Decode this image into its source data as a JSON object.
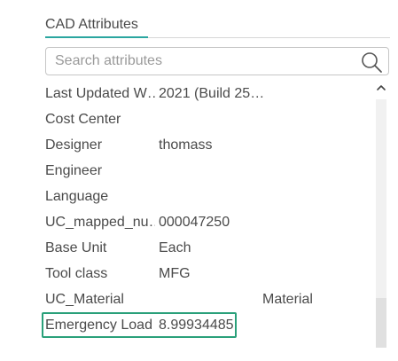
{
  "panel": {
    "tab_label": "CAD Attributes",
    "accent_color": "#2aa6a0",
    "highlight_color": "#2aa07a"
  },
  "search": {
    "placeholder": "Search attributes",
    "value": "",
    "icon": "search-icon"
  },
  "attributes": [
    {
      "key": "Last Updated W…",
      "value": "2021 (Build 25…"
    },
    {
      "key": "Cost Center",
      "value": ""
    },
    {
      "key": "Designer",
      "value": "thomass"
    },
    {
      "key": "Engineer",
      "value": ""
    },
    {
      "key": "Language",
      "value": ""
    },
    {
      "key": "UC_mapped_nu…",
      "value": "000047250"
    },
    {
      "key": "Base Unit",
      "value": "Each"
    },
    {
      "key": "Tool class",
      "value": "MFG"
    },
    {
      "key": "UC_Material",
      "value": "Material"
    },
    {
      "key": "Emergency Load",
      "value": "8.99934485"
    }
  ],
  "scrollbar": {
    "up_icon": "chevron-up-icon"
  }
}
